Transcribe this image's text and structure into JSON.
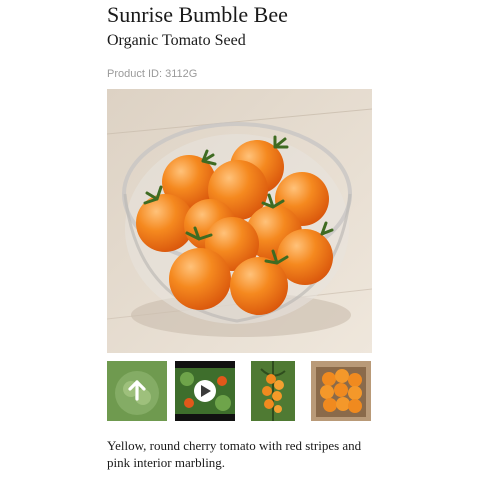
{
  "product": {
    "title": "Sunrise Bumble Bee",
    "subtitle": "Organic Tomato Seed",
    "product_id": "Product ID: 3112G",
    "description": "Yellow, round cherry tomato with red stripes and pink interior marbling."
  },
  "gallery": {
    "main_image": "photo of orange-striped cherry tomatoes in a glass bowl",
    "thumbnails": [
      {
        "icon": "up-arrow-icon"
      },
      {
        "icon": "play-icon"
      },
      {
        "icon": "none"
      },
      {
        "icon": "none"
      }
    ]
  },
  "colors": {
    "tomato": "#f07b18",
    "tomato_highlight": "#ffb060",
    "stem": "#3f6b22",
    "table": "#e6dcd0"
  }
}
